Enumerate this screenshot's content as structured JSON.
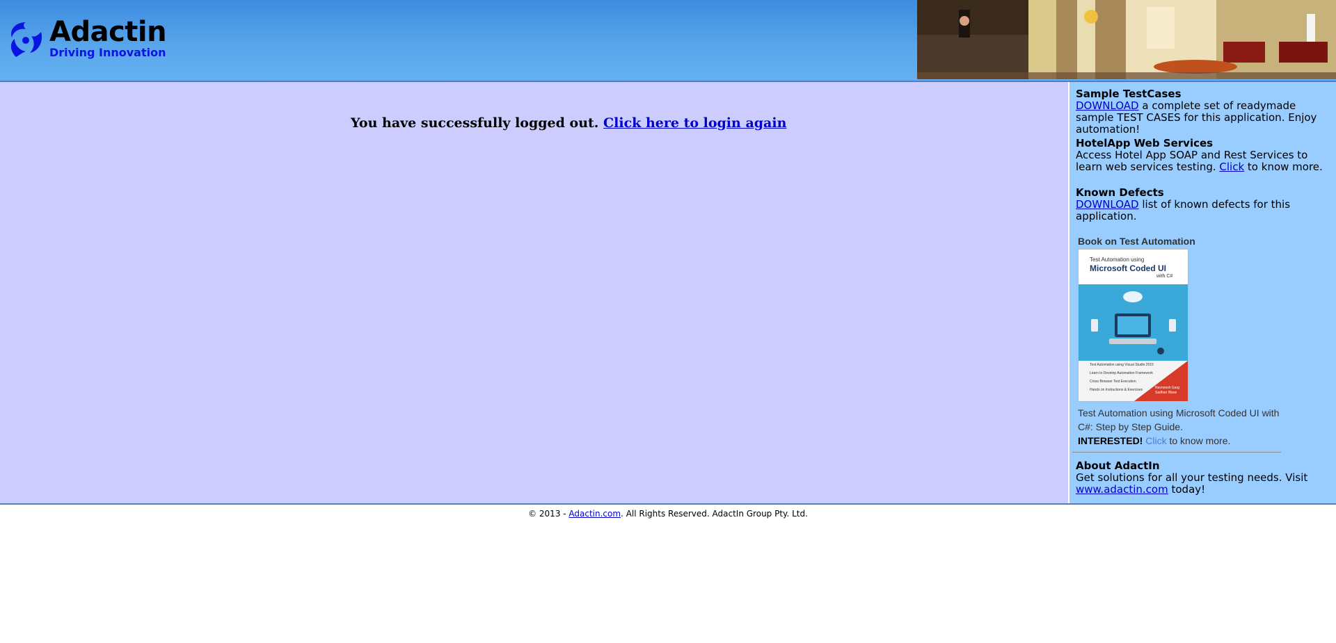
{
  "header": {
    "logo_text": "Adactin",
    "logo_tagline": "Driving Innovation"
  },
  "main": {
    "logout_message": "You have successfully logged out. ",
    "login_again_link": "Click here to login again"
  },
  "sidebar": {
    "sample_testcases": {
      "heading": "Sample TestCases",
      "link": "DOWNLOAD",
      "text": " a complete set of readymade sample TEST CASES for this application. Enjoy automation!"
    },
    "web_services": {
      "heading": "HotelApp Web Services",
      "text": "Access Hotel App SOAP and Rest Services to learn web services testing. ",
      "link": "Click",
      "text_after": " to know more."
    },
    "known_defects": {
      "heading": "Known Defects",
      "link": "DOWNLOAD",
      "text": " list of known defects for this application."
    },
    "book": {
      "heading": "Book on Test Automation",
      "cover_top": "Test Automation using",
      "cover_title": "Microsoft Coded UI",
      "cover_sub": "with C#",
      "cover_bullets": [
        "Test Automation using Visual Studio 2015",
        "Learn to Develop Automation Framework",
        "Cross Browser Test Execution",
        "Hands on Instructions & Exercises"
      ],
      "cover_authors": "Navneesh Garg\nSadhan Wase",
      "description": "Test Automation using Microsoft Coded UI with C#: Step by Step Guide.",
      "interested": "INTERESTED!",
      "link": "Click",
      "text_after": " to know more."
    },
    "about": {
      "heading": "About AdactIn",
      "text": "Get solutions for all your testing needs. Visit ",
      "link": "www.adactin.com",
      "text_after": " today!"
    }
  },
  "footer": {
    "prefix": "© 2013 - ",
    "link": "Adactin.com",
    "suffix": ". All Rights Reserved. AdactIn Group Pty. Ltd."
  },
  "colors": {
    "header_blue": "#5aa7ec",
    "main_bg": "#ccccff",
    "sidebar_bg": "#99ccff",
    "link": "#0000cc",
    "tagline": "#0a14e0"
  }
}
